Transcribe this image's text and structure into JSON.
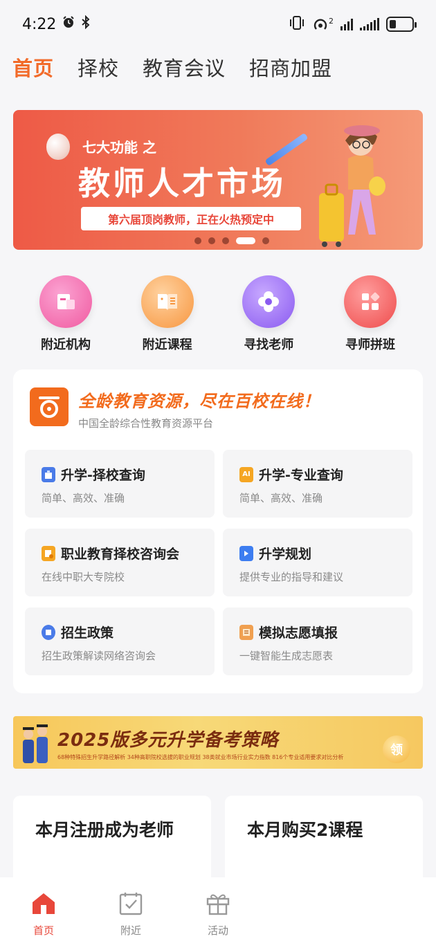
{
  "status": {
    "time": "4:22",
    "network_sup": "2"
  },
  "top_tabs": [
    {
      "label": "首页",
      "active": true
    },
    {
      "label": "择校",
      "active": false
    },
    {
      "label": "教育会议",
      "active": false
    },
    {
      "label": "招商加盟",
      "active": false
    }
  ],
  "banner": {
    "subtitle": "七大功能 之",
    "title": "教师人才市场",
    "pill": "第六届顶岗教师，正在火热预定中",
    "slides": 5,
    "active_slide": 4
  },
  "quick": [
    {
      "label": "附近机构",
      "icon": "institution-icon",
      "color": "#f26fb0"
    },
    {
      "label": "附近课程",
      "icon": "course-book-icon",
      "color": "#f8a45a"
    },
    {
      "label": "寻找老师",
      "icon": "flower-icon",
      "color": "#9b6cf0"
    },
    {
      "label": "寻师拼班",
      "icon": "grid-apps-icon",
      "color": "#f05a5a"
    }
  ],
  "card": {
    "slogan": "全龄教育资源，尽在百校在线！",
    "subtitle": "中国全龄综合性教育资源平台",
    "items": [
      {
        "title": "升学-择校查询",
        "sub": "简单、高效、准确",
        "icon": "school-building-icon",
        "color": "#4a7be8"
      },
      {
        "title": "升学-专业查询",
        "sub": "简单、高效、准确",
        "icon": "ai-major-icon",
        "color": "#f5a623"
      },
      {
        "title": "职业教育择校咨询会",
        "sub": "在线中职大专院校",
        "icon": "consult-icon",
        "color": "#f5a623"
      },
      {
        "title": "升学规划",
        "sub": "提供专业的指导和建议",
        "icon": "planning-icon",
        "color": "#3d7df0"
      },
      {
        "title": "招生政策",
        "sub": "招生政策解读网络咨询会",
        "icon": "policy-icon",
        "color": "#4a7be8"
      },
      {
        "title": "模拟志愿填报",
        "sub": "一键智能生成志愿表",
        "icon": "form-scroll-icon",
        "color": "#f0a050"
      }
    ]
  },
  "promo": {
    "title": "2025版多元升学备考策略",
    "details": "68种特殊招生升学路径解析 34种高职院校选拔的职业规划 38类就业市场行业实力指数 816个专业适用要求对比分析",
    "badge": "领"
  },
  "bottom_cards": [
    {
      "title": "本月注册成为老师"
    },
    {
      "title": "本月购买2课程"
    }
  ],
  "nav": [
    {
      "label": "首页",
      "icon": "home-icon",
      "active": true
    },
    {
      "label": "附近",
      "icon": "nearby-check-icon",
      "active": false
    },
    {
      "label": "活动",
      "icon": "gift-icon",
      "active": false
    }
  ]
}
